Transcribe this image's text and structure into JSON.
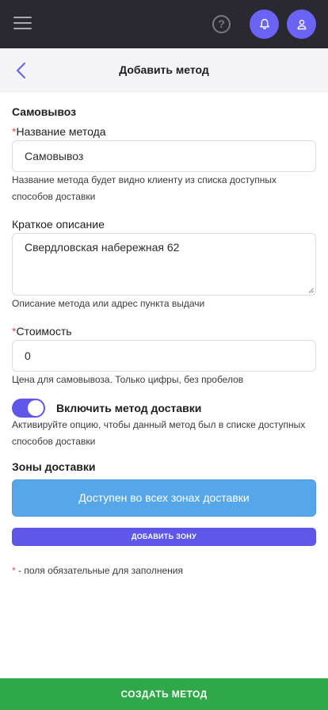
{
  "header": {
    "menu_icon": "hamburger-icon",
    "help_icon": "question-circle-icon",
    "help_glyph": "?",
    "bell_icon": "bell-icon",
    "user_icon": "user-icon",
    "accent_color": "#6b63f6",
    "bar_color": "#2a2831"
  },
  "subheader": {
    "back_icon": "chevron-left-icon",
    "title": "Добавить метод"
  },
  "form": {
    "section_title": "Самовывоз",
    "name": {
      "required_mark": "*",
      "label": "Название метода",
      "value": "Самовывоз",
      "hint": "Название метода будет видно клиенту из списка доступных способов доставки"
    },
    "description": {
      "label": "Краткое описание",
      "value": "Свердловская набережная 62",
      "hint": "Описание метода или адрес пункта выдачи"
    },
    "cost": {
      "required_mark": "*",
      "label": "Стоимость",
      "value": "0",
      "hint": "Цена для самовывоза. Только цифры, без пробелов"
    },
    "enable": {
      "checked": true,
      "label": "Включить метод доставки",
      "hint": "Активируйте опцию, чтобы данный метод был в списке доступных способов доставки"
    },
    "zones": {
      "title": "Зоны доставки",
      "all_zones_label": "Доступен во всех зонах доставки",
      "add_zone_label": "ДОБАВИТЬ ЗОНУ"
    },
    "required_note": {
      "mark": "*",
      "text": " - поля обязательные для заполнения"
    }
  },
  "footer": {
    "create_label": "СОЗДАТЬ МЕТОД",
    "color": "#2fa84a"
  }
}
